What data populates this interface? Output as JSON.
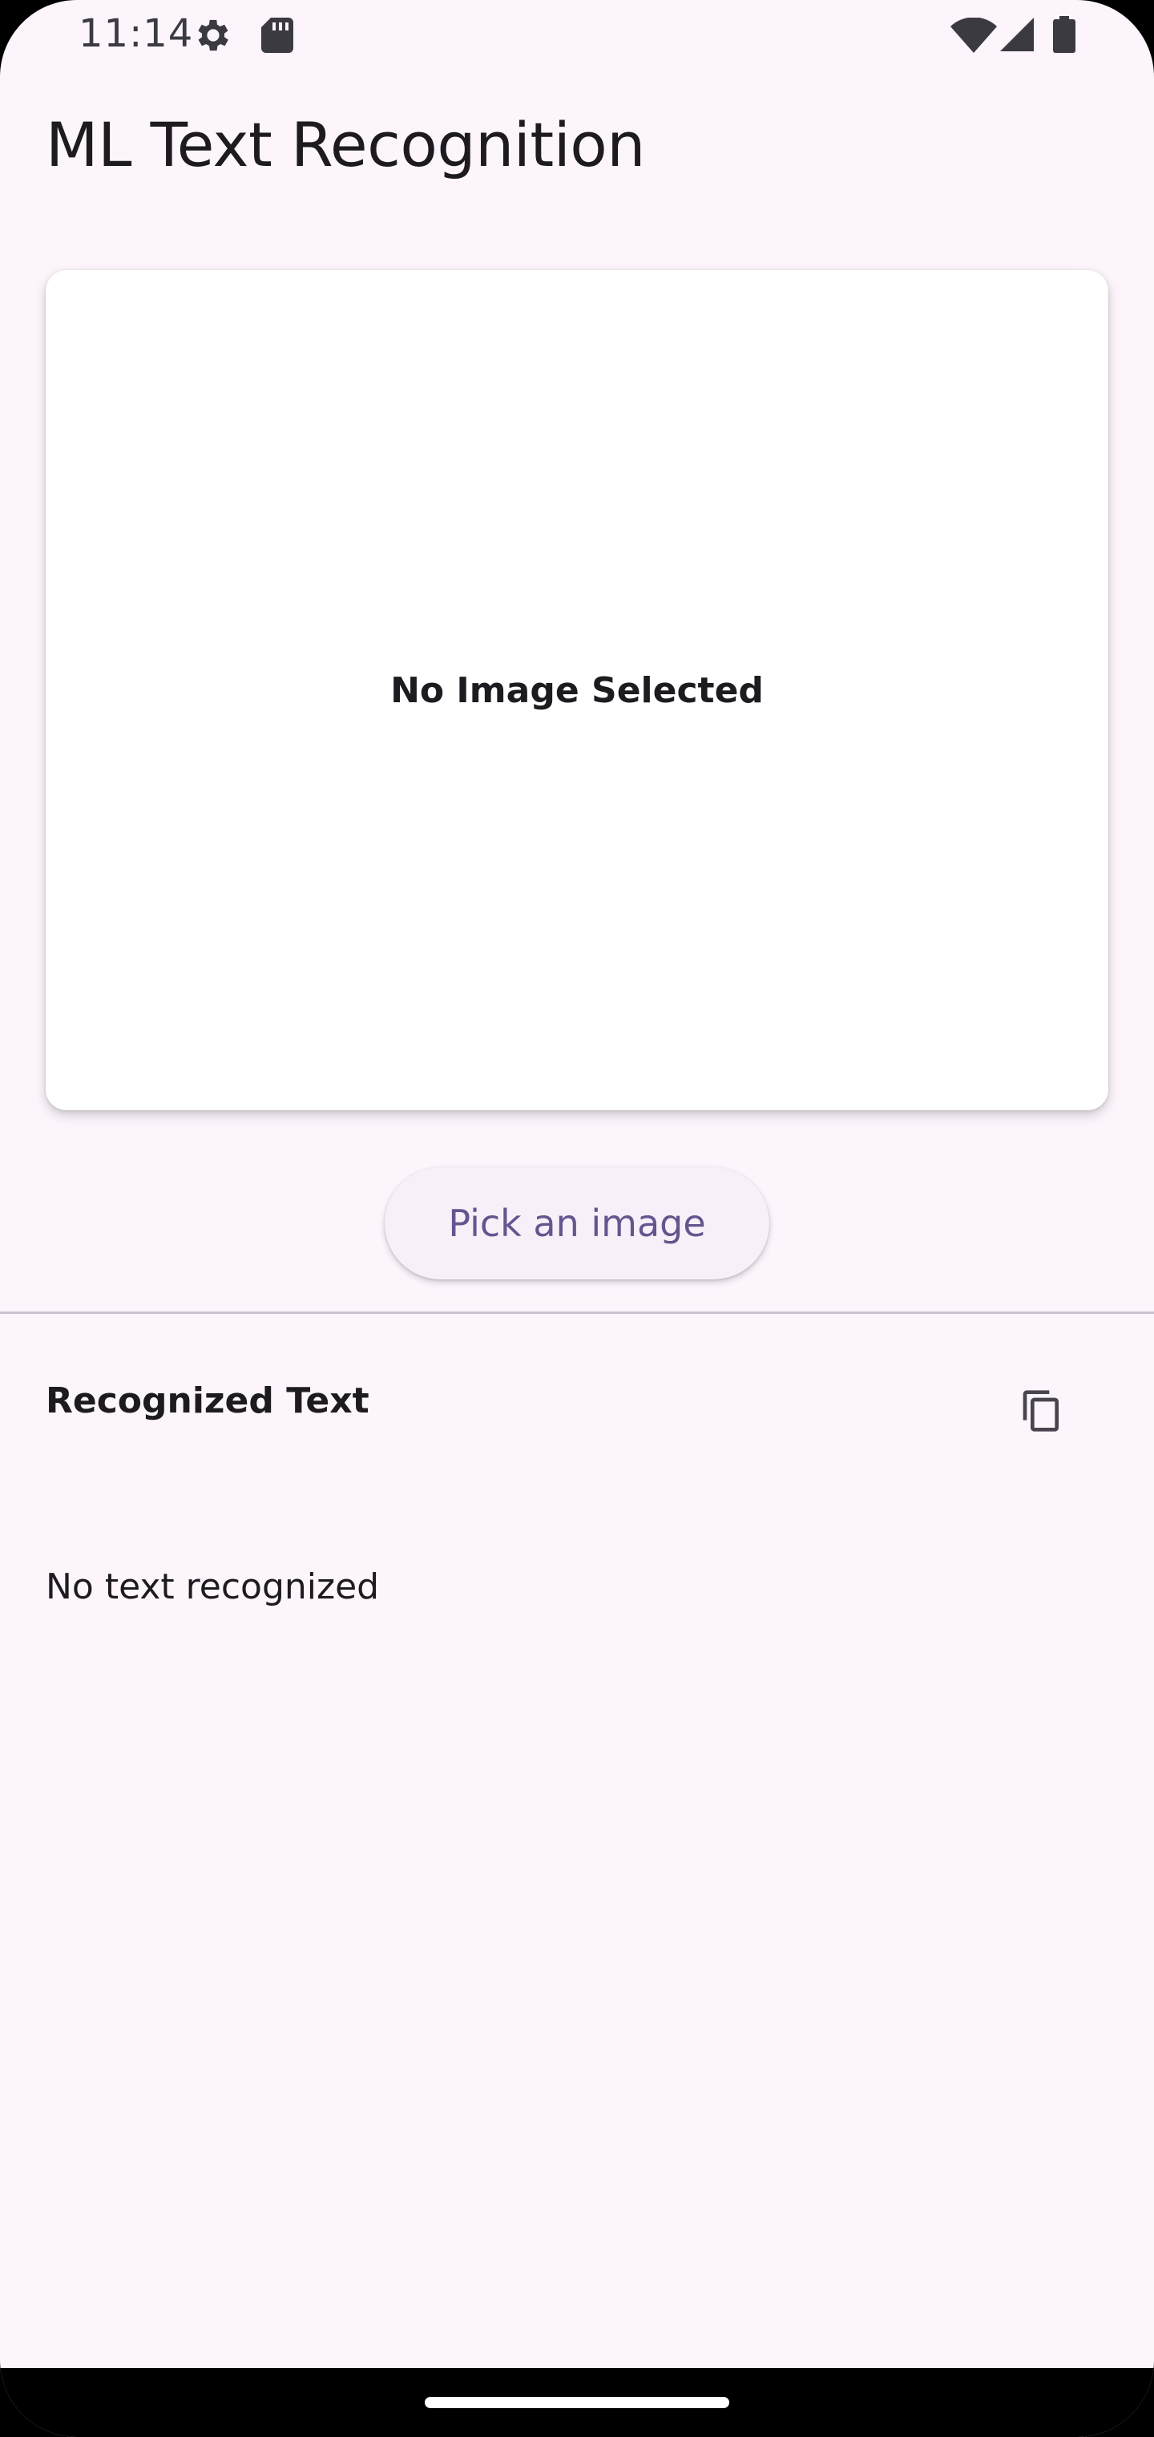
{
  "status_bar": {
    "time": "11:14",
    "icons": [
      "settings-gear-icon",
      "sd-card-icon",
      "wifi-icon",
      "cell-signal-icon",
      "battery-icon"
    ]
  },
  "app_bar": {
    "title": "ML Text Recognition"
  },
  "image_card": {
    "placeholder": "No Image Selected"
  },
  "pick_button": {
    "label": "Pick an image"
  },
  "recognized_section": {
    "title": "Recognized Text",
    "copy_icon": "copy-icon",
    "body": "No text recognized"
  },
  "colors": {
    "background": "#fcf5fc",
    "card": "#ffffff",
    "button_text": "#65558f",
    "button_bg": "#f7f0f8",
    "text": "#1d1b20",
    "divider": "#cac4d0"
  }
}
